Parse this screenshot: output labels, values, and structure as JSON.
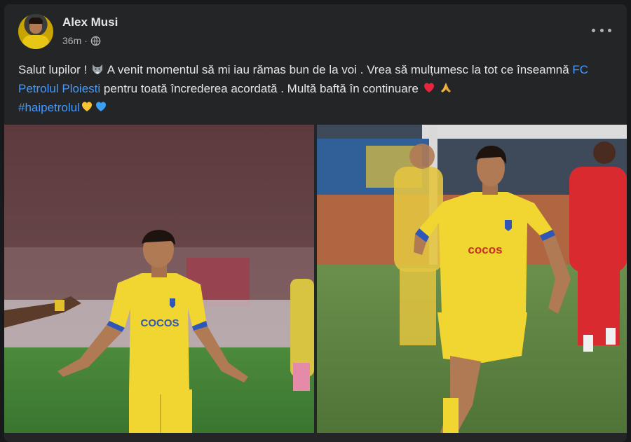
{
  "post": {
    "author": "Alex Musi",
    "time": "36m",
    "text": {
      "part1": "Salut lupilor ! ",
      "part2": " A venit momentul să mi iau rămas bun de la voi . Vrea să mulțumesc la tot ce înseamnă ",
      "page_link": "FC Petrolul Ploiesti",
      "part3": " pentru toată încrederea acordată . Multă baftă în continuare ",
      "hashtag": "#haipetrolul"
    },
    "photos": {
      "left": {
        "shirt_sponsor": "COCOS"
      },
      "right": {
        "shirt_sponsor": "cocos"
      }
    }
  },
  "colors": {
    "background": "#18191a",
    "card": "#242526",
    "text_primary": "#e4e6eb",
    "text_secondary": "#b0b3b8",
    "link": "#4599ff",
    "kit_yellow": "#f1d531",
    "kit_blue": "#2f57b8"
  },
  "icons": [
    "globe-icon",
    "more-options-icon",
    "wolf-emoji",
    "red-heart-emoji",
    "folded-hands-emoji",
    "yellow-heart-emoji",
    "blue-heart-emoji"
  ]
}
